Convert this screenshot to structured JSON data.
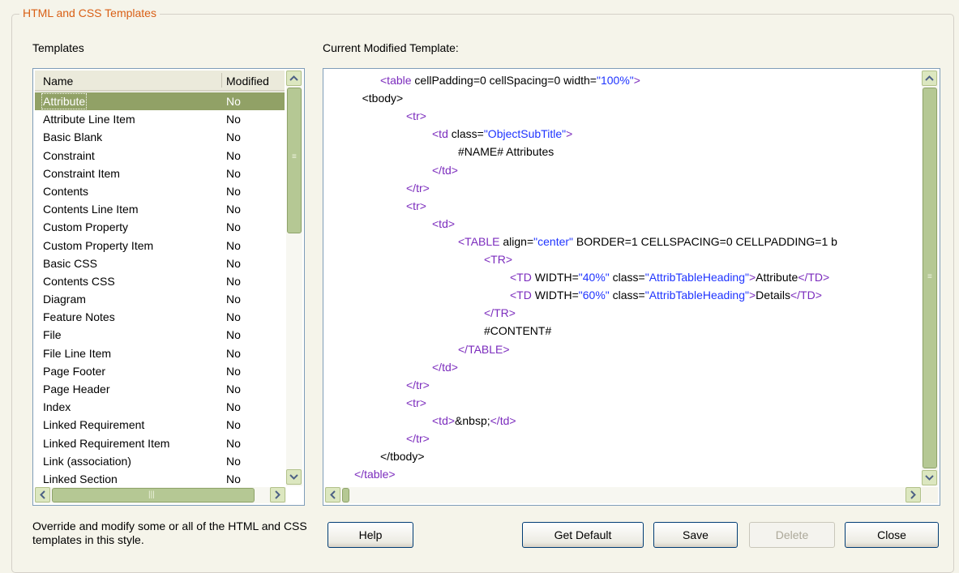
{
  "group": {
    "title": "HTML and CSS Templates"
  },
  "templates": {
    "label": "Templates",
    "columns": {
      "name": "Name",
      "modified": "Modified"
    },
    "rows": [
      {
        "name": "Attribute",
        "modified": "No",
        "selected": true
      },
      {
        "name": "Attribute Line Item",
        "modified": "No"
      },
      {
        "name": "Basic Blank",
        "modified": "No"
      },
      {
        "name": "Constraint",
        "modified": "No"
      },
      {
        "name": "Constraint Item",
        "modified": "No"
      },
      {
        "name": "Contents",
        "modified": "No"
      },
      {
        "name": "Contents Line Item",
        "modified": "No"
      },
      {
        "name": "Custom Property",
        "modified": "No"
      },
      {
        "name": "Custom Property Item",
        "modified": "No"
      },
      {
        "name": "Basic CSS",
        "modified": "No"
      },
      {
        "name": "Contents CSS",
        "modified": "No"
      },
      {
        "name": "Diagram",
        "modified": "No"
      },
      {
        "name": "Feature Notes",
        "modified": "No"
      },
      {
        "name": "File",
        "modified": "No"
      },
      {
        "name": "File Line Item",
        "modified": "No"
      },
      {
        "name": "Page Footer",
        "modified": "No"
      },
      {
        "name": "Page Header",
        "modified": "No"
      },
      {
        "name": "Index",
        "modified": "No"
      },
      {
        "name": "Linked Requirement",
        "modified": "No"
      },
      {
        "name": "Linked Requirement Item",
        "modified": "No"
      },
      {
        "name": "Link (association)",
        "modified": "No"
      },
      {
        "name": "Linked Section",
        "modified": "No"
      }
    ]
  },
  "editor": {
    "label": "Current Modified Template:",
    "lines": [
      {
        "indent": 1,
        "parts": [
          {
            "t": "<table",
            "c": "tag"
          },
          {
            "t": " cellPadding=0 cellSpacing=0 width=",
            "c": ""
          },
          {
            "t": "\"100%\"",
            "c": "val"
          },
          {
            "t": ">",
            "c": "tag"
          }
        ]
      },
      {
        "indent": 0.3,
        "parts": [
          {
            "t": "<tbody>",
            "c": ""
          }
        ]
      },
      {
        "indent": 2,
        "parts": [
          {
            "t": "<tr>",
            "c": "tag"
          }
        ]
      },
      {
        "indent": 3,
        "parts": [
          {
            "t": "<td",
            "c": "tag"
          },
          {
            "t": " class=",
            "c": ""
          },
          {
            "t": "\"ObjectSubTitle\"",
            "c": "val"
          },
          {
            "t": ">",
            "c": "tag"
          }
        ]
      },
      {
        "indent": 4,
        "parts": [
          {
            "t": "#NAME# Attributes",
            "c": ""
          }
        ]
      },
      {
        "indent": 3,
        "parts": [
          {
            "t": "</td>",
            "c": "tag"
          }
        ]
      },
      {
        "indent": 2,
        "parts": [
          {
            "t": "</tr>",
            "c": "tag"
          }
        ]
      },
      {
        "indent": 2,
        "parts": [
          {
            "t": "<tr>",
            "c": "tag"
          }
        ]
      },
      {
        "indent": 3,
        "parts": [
          {
            "t": "<td>",
            "c": "tag"
          }
        ]
      },
      {
        "indent": 4,
        "parts": [
          {
            "t": "<TABLE",
            "c": "tag"
          },
          {
            "t": " align=",
            "c": ""
          },
          {
            "t": "\"center\"",
            "c": "val"
          },
          {
            "t": " BORDER=1 CELLSPACING=0 CELLPADDING=1 b",
            "c": ""
          }
        ]
      },
      {
        "indent": 5,
        "parts": [
          {
            "t": "<TR>",
            "c": "tag"
          }
        ]
      },
      {
        "indent": 6,
        "parts": [
          {
            "t": "<TD",
            "c": "tag"
          },
          {
            "t": " WIDTH=",
            "c": ""
          },
          {
            "t": "\"40%\"",
            "c": "val"
          },
          {
            "t": " class=",
            "c": ""
          },
          {
            "t": "\"AttribTableHeading\"",
            "c": "val"
          },
          {
            "t": ">",
            "c": "tag"
          },
          {
            "t": "Attribute",
            "c": ""
          },
          {
            "t": "</TD>",
            "c": "tag"
          }
        ]
      },
      {
        "indent": 6,
        "parts": [
          {
            "t": "<TD",
            "c": "tag"
          },
          {
            "t": " WIDTH=",
            "c": ""
          },
          {
            "t": "\"60%\"",
            "c": "val"
          },
          {
            "t": " class=",
            "c": ""
          },
          {
            "t": "\"AttribTableHeading\"",
            "c": "val"
          },
          {
            "t": ">",
            "c": "tag"
          },
          {
            "t": "Details",
            "c": ""
          },
          {
            "t": "</TD>",
            "c": "tag"
          }
        ]
      },
      {
        "indent": 5,
        "parts": [
          {
            "t": "</TR>",
            "c": "tag"
          }
        ]
      },
      {
        "indent": 5,
        "parts": [
          {
            "t": "#CONTENT#",
            "c": ""
          }
        ]
      },
      {
        "indent": 4,
        "parts": [
          {
            "t": "</TABLE>",
            "c": "tag"
          }
        ]
      },
      {
        "indent": 3,
        "parts": [
          {
            "t": "</td>",
            "c": "tag"
          }
        ]
      },
      {
        "indent": 2,
        "parts": [
          {
            "t": "</tr>",
            "c": "tag"
          }
        ]
      },
      {
        "indent": 2,
        "parts": [
          {
            "t": "<tr>",
            "c": "tag"
          }
        ]
      },
      {
        "indent": 3,
        "parts": [
          {
            "t": "<td>",
            "c": "tag"
          },
          {
            "t": "&nbsp;",
            "c": ""
          },
          {
            "t": "</td>",
            "c": "tag"
          }
        ]
      },
      {
        "indent": 2,
        "parts": [
          {
            "t": "</tr>",
            "c": "tag"
          }
        ]
      },
      {
        "indent": 1,
        "parts": [
          {
            "t": "</tbody>",
            "c": ""
          }
        ]
      },
      {
        "indent": 0,
        "parts": [
          {
            "t": "</table>",
            "c": "tag"
          }
        ]
      }
    ]
  },
  "description": "Override and modify some or all of the HTML and CSS templates in this style.",
  "buttons": {
    "help": "Help",
    "get_default": "Get Default",
    "save": "Save",
    "delete": "Delete",
    "close": "Close"
  },
  "icons": {
    "scroll_up": "chevron-up-icon",
    "scroll_down": "chevron-down-icon",
    "scroll_left": "chevron-left-icon",
    "scroll_right": "chevron-right-icon"
  },
  "colors": {
    "group_title": "#d95f15",
    "selection": "#91a166",
    "tag": "#7b2bbd",
    "value": "#1f34ff",
    "scroll": "#b5c894"
  }
}
